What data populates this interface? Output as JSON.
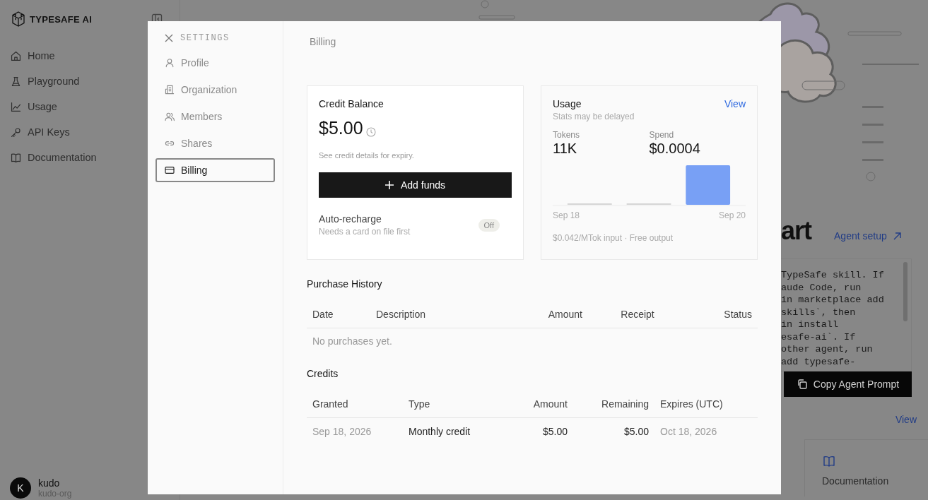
{
  "sidebar": {
    "brand": "TYPESAFE AI",
    "items": [
      {
        "label": "Home",
        "kind": "home"
      },
      {
        "label": "Playground",
        "kind": "flask"
      },
      {
        "label": "Usage",
        "kind": "chart"
      },
      {
        "label": "API Keys",
        "kind": "key"
      },
      {
        "label": "Documentation",
        "kind": "book"
      }
    ],
    "user": {
      "initial": "K",
      "name": "kudo",
      "org": "kudo-org"
    }
  },
  "background": {
    "heading": "art",
    "link": "Agent setup",
    "code_lines": [
      "TypeSafe skill. If",
      "aude Code, run",
      "in marketplace add",
      "skills`, then",
      "in install",
      "esafe-ai`. If",
      "other agent, run",
      "add typesafe-"
    ],
    "copy_button": "Copy Agent Prompt",
    "view_link": "View",
    "doc_card": "Documentation"
  },
  "settings": {
    "title": "SETTINGS",
    "nav": [
      {
        "label": "Profile",
        "kind": "user",
        "selected": false
      },
      {
        "label": "Organization",
        "kind": "building",
        "selected": false
      },
      {
        "label": "Members",
        "kind": "users",
        "selected": false
      },
      {
        "label": "Shares",
        "kind": "link",
        "selected": false
      },
      {
        "label": "Billing",
        "kind": "card",
        "selected": true
      }
    ],
    "page_title": "Billing",
    "credit_balance": {
      "title": "Credit Balance",
      "amount": "$5.00",
      "note": "See credit details for expiry.",
      "button": "Add funds",
      "auto_recharge": {
        "label": "Auto-recharge",
        "hint": "Needs a card on file first",
        "on": false,
        "state_label": "Off"
      }
    },
    "usage": {
      "title": "Usage",
      "link": "View",
      "subtitle": "Stats may be delayed",
      "stats": [
        {
          "label": "Tokens",
          "value": "11K"
        },
        {
          "label": "Spend",
          "value": "$0.0004"
        }
      ],
      "axis_labels": [
        "Sep 18",
        "Sep 20"
      ],
      "pricing": "$0.042/MTok input · Free output"
    },
    "purchase_history": {
      "title": "Purchase History",
      "columns": [
        "Date",
        "Description",
        "Amount",
        "Receipt",
        "Status"
      ],
      "empty": "No purchases yet."
    },
    "credits": {
      "title": "Credits",
      "columns": [
        "Granted",
        "Type",
        "Amount",
        "Remaining",
        "Expires (UTC)"
      ],
      "rows": [
        [
          "Sep 18, 2026",
          "Monthly credit",
          "$5.00",
          "$5.00",
          "Oct 18, 2026"
        ]
      ]
    }
  }
}
